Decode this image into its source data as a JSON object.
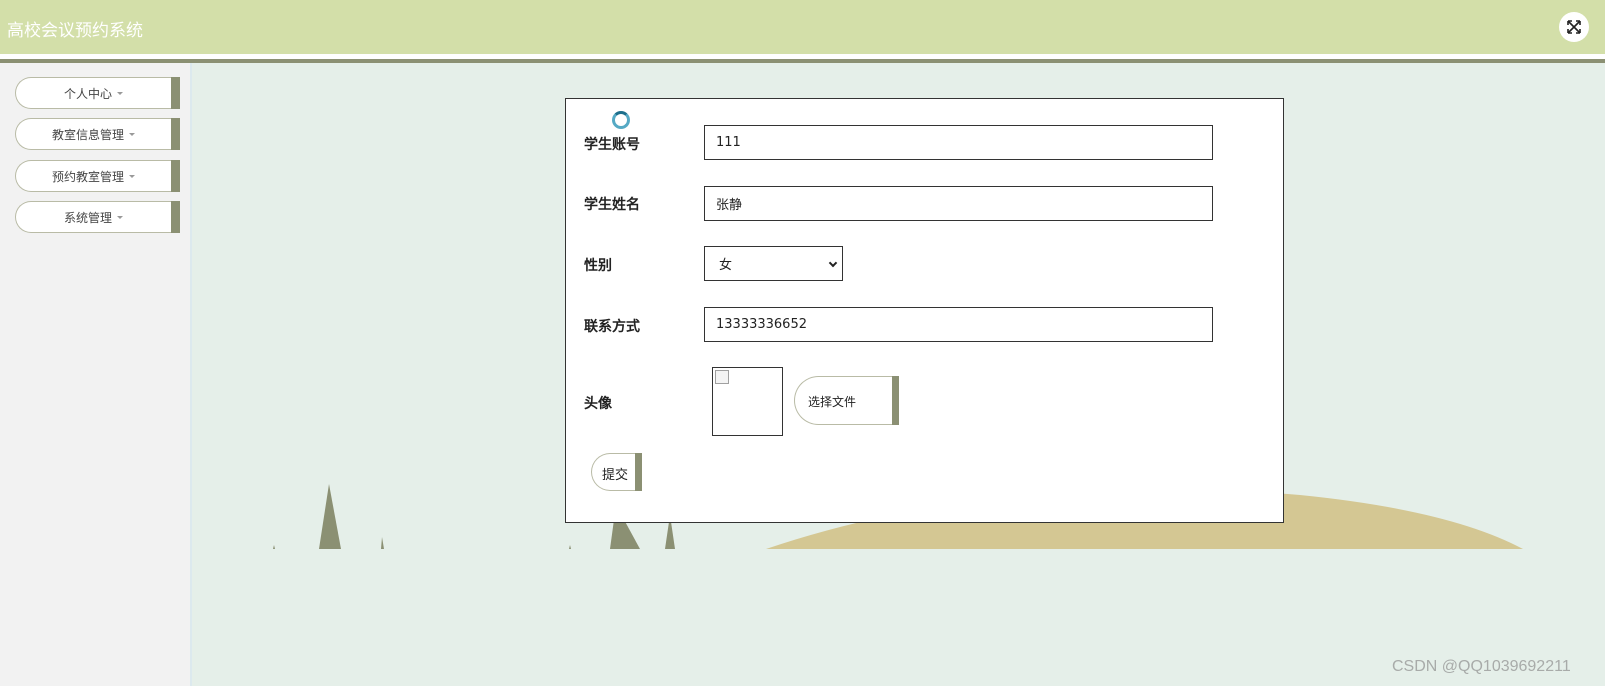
{
  "header": {
    "app_title": "高校会议预约系统",
    "fullscreen_icon": "expand-arrows-icon"
  },
  "sidebar": {
    "items": [
      {
        "label": "个人中心"
      },
      {
        "label": "教室信息管理"
      },
      {
        "label": "预约教室管理"
      },
      {
        "label": "系统管理"
      }
    ]
  },
  "form": {
    "account": {
      "label": "学生账号",
      "value": "111"
    },
    "name": {
      "label": "学生姓名",
      "value": "张静"
    },
    "gender": {
      "label": "性别",
      "selected": "女"
    },
    "phone": {
      "label": "联系方式",
      "value": "13333336652"
    },
    "avatar": {
      "label": "头像",
      "choose_file": "选择文件"
    },
    "submit": "提交"
  },
  "watermark": "CSDN @QQ1039692211",
  "colors": {
    "header_bg": "#d3dfa9",
    "accent": "#8b9073",
    "page_bg": "#e5efe9",
    "hill": "#d4c793",
    "tree": "#8b9073"
  }
}
